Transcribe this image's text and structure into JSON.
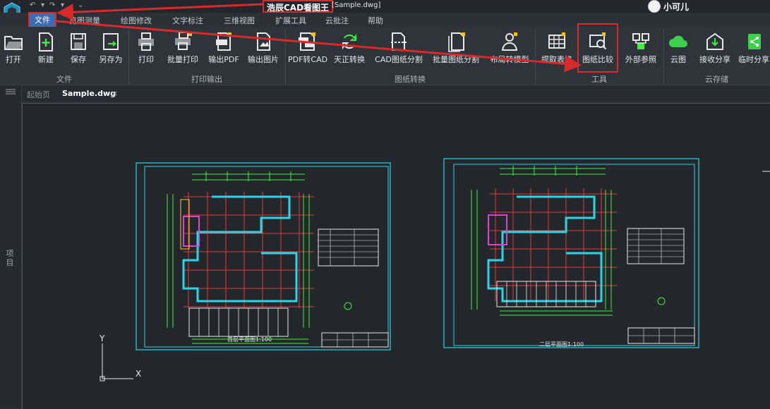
{
  "app": {
    "title": "浩辰CAD看图王",
    "document": "[Sample.dwg]",
    "user": "小可儿"
  },
  "menu": {
    "file": "文件",
    "items": [
      "览图测量",
      "绘图修改",
      "文字标注",
      "三维视图",
      "扩展工具",
      "云批注",
      "帮助"
    ]
  },
  "ribbon": {
    "buttons": [
      {
        "label": "打开",
        "icon": "folder-open-icon"
      },
      {
        "label": "新建",
        "icon": "new-file-icon"
      },
      {
        "label": "保存",
        "icon": "save-icon"
      },
      {
        "label": "另存为",
        "icon": "save-as-icon"
      },
      {
        "label": "打印",
        "icon": "print-icon"
      },
      {
        "label": "批量打印",
        "icon": "batch-print-icon"
      },
      {
        "label": "输出PDF",
        "icon": "pdf-icon"
      },
      {
        "label": "输出图片",
        "icon": "image-export-icon"
      },
      {
        "label": "PDF转CAD",
        "icon": "pdf-to-cad-icon"
      },
      {
        "label": "天正转换",
        "icon": "convert-icon"
      },
      {
        "label": "CAD图纸分割",
        "icon": "split-icon"
      },
      {
        "label": "批量图纸分割",
        "icon": "batch-split-icon"
      },
      {
        "label": "布局转模型",
        "icon": "layout-model-icon"
      },
      {
        "label": "提取表格",
        "icon": "table-extract-icon"
      },
      {
        "label": "图纸比较",
        "icon": "compare-icon"
      },
      {
        "label": "外部参照",
        "icon": "external-ref-icon"
      },
      {
        "label": "云图",
        "icon": "cloud-icon"
      },
      {
        "label": "接收分享",
        "icon": "receive-share-icon"
      },
      {
        "label": "临时分享",
        "icon": "temp-share-icon"
      }
    ],
    "groups": [
      "文件",
      "打印输出",
      "图纸转换",
      "工具",
      "云存储"
    ]
  },
  "tabs": {
    "start": "起始页",
    "sample": "Sample.dwg",
    "close": "×"
  },
  "sidebar": {
    "label": "项目"
  },
  "drawing": {
    "sheet1_title": "首层平面图1:100",
    "sheet2_title": "二层平面图1:100",
    "axis_x": "X",
    "axis_y": "Y"
  },
  "colors": {
    "accent": "#d82a2a",
    "file_menu": "#3c6db0",
    "cyan": "#27d6e8",
    "green": "#3ef03e",
    "red": "#e23b3b"
  }
}
